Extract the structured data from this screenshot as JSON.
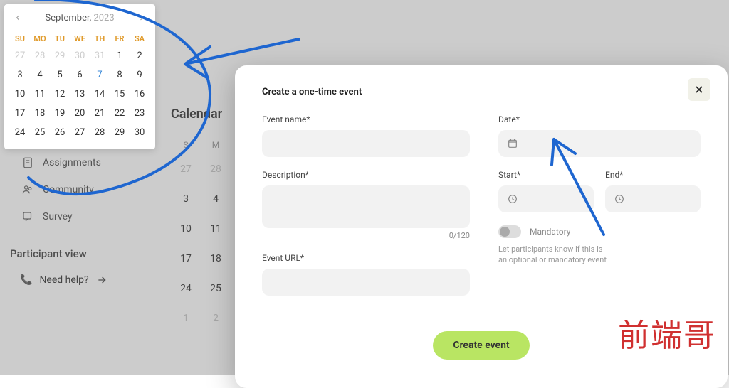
{
  "sidebar": {
    "items": [
      {
        "label": "Assignments",
        "icon": "assignment-icon"
      },
      {
        "label": "Community",
        "icon": "community-icon"
      },
      {
        "label": "Survey",
        "icon": "survey-icon"
      }
    ],
    "participant_heading": "Participant view",
    "need_help": "Need help?"
  },
  "calendar_bg": {
    "title": "Calendar",
    "dow": [
      "S",
      "M"
    ],
    "rows": [
      [
        "27",
        "28"
      ],
      [
        "3",
        "4"
      ],
      [
        "10",
        "11"
      ],
      [
        "17",
        "18"
      ],
      [
        "24",
        "25"
      ],
      [
        "1",
        "2"
      ]
    ]
  },
  "date_picker": {
    "month": "September,",
    "year": "2023",
    "dow": [
      "SU",
      "MO",
      "TU",
      "WE",
      "TH",
      "FR",
      "SA"
    ],
    "weeks": [
      [
        {
          "d": "27",
          "gray": true
        },
        {
          "d": "28",
          "gray": true
        },
        {
          "d": "29",
          "gray": true
        },
        {
          "d": "30",
          "gray": true
        },
        {
          "d": "31",
          "gray": true
        },
        {
          "d": "1"
        },
        {
          "d": "2"
        }
      ],
      [
        {
          "d": "3"
        },
        {
          "d": "4"
        },
        {
          "d": "5"
        },
        {
          "d": "6"
        },
        {
          "d": "7",
          "today": true
        },
        {
          "d": "8"
        },
        {
          "d": "9"
        }
      ],
      [
        {
          "d": "10"
        },
        {
          "d": "11"
        },
        {
          "d": "12"
        },
        {
          "d": "13"
        },
        {
          "d": "14"
        },
        {
          "d": "15"
        },
        {
          "d": "16"
        }
      ],
      [
        {
          "d": "17"
        },
        {
          "d": "18"
        },
        {
          "d": "19"
        },
        {
          "d": "20"
        },
        {
          "d": "21"
        },
        {
          "d": "22"
        },
        {
          "d": "23"
        }
      ],
      [
        {
          "d": "24"
        },
        {
          "d": "25"
        },
        {
          "d": "26"
        },
        {
          "d": "27"
        },
        {
          "d": "28"
        },
        {
          "d": "29"
        },
        {
          "d": "30"
        }
      ]
    ]
  },
  "modal": {
    "title": "Create a one-time event",
    "event_name_label": "Event name*",
    "description_label": "Description*",
    "char_count": "0/120",
    "event_url_label": "Event URL*",
    "date_label": "Date*",
    "start_label": "Start*",
    "end_label": "End*",
    "mandatory_label": "Mandatory",
    "mandatory_help": "Let participants know if this is an optional or mandatory event",
    "submit": "Create event"
  },
  "watermark": "前端哥"
}
